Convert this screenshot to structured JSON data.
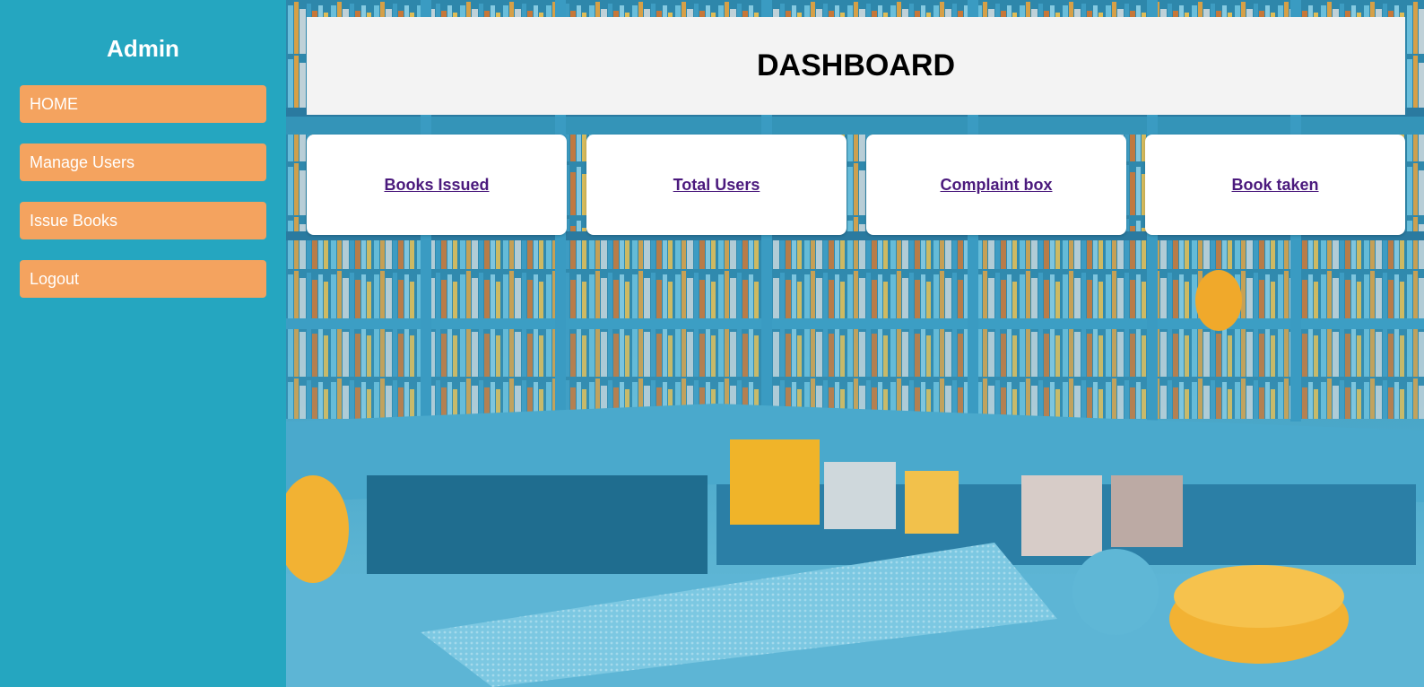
{
  "sidebar": {
    "title": "Admin",
    "items": [
      {
        "label": "HOME"
      },
      {
        "label": "Manage Users"
      },
      {
        "label": "Issue Books"
      },
      {
        "label": "Logout"
      }
    ]
  },
  "header": {
    "title": "DASHBOARD"
  },
  "cards": [
    {
      "label": "Books Issued"
    },
    {
      "label": "Total Users"
    },
    {
      "label": "Complaint box"
    },
    {
      "label": "Book taken"
    }
  ],
  "colors": {
    "sidebar_bg": "#25a6c0",
    "nav_button": "#f4a35f",
    "header_bg": "#f3f3f3",
    "card_link": "#4b1a7d"
  }
}
